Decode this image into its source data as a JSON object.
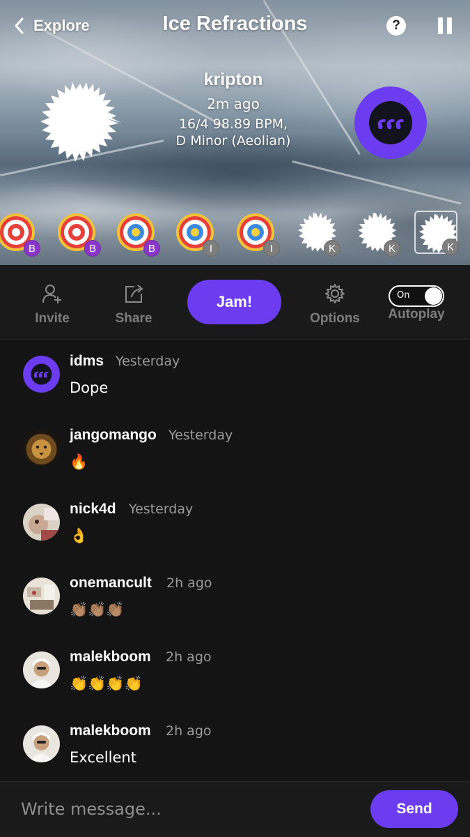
{
  "header": {
    "back_label": "Explore",
    "title": "Ice Refractions",
    "help_label": "?"
  },
  "song": {
    "author": "kripton",
    "time_ago": "2m ago",
    "tempo": "16/4 98.89 BPM,",
    "key": "D Minor (Aeolian)"
  },
  "instruments": [
    {
      "badge": "B",
      "style": "ring-red",
      "selected": false
    },
    {
      "badge": "B",
      "style": "ring-red",
      "selected": false
    },
    {
      "badge": "B",
      "style": "ring-blue",
      "selected": false
    },
    {
      "badge": "I",
      "style": "ring-blue",
      "selected": false
    },
    {
      "badge": "I",
      "style": "ring-blue",
      "selected": false
    },
    {
      "badge": "K",
      "style": "blob-white",
      "selected": false
    },
    {
      "badge": "K",
      "style": "blob-white",
      "selected": false
    },
    {
      "badge": "K",
      "style": "blob-white",
      "selected": true
    }
  ],
  "toolbar": {
    "invite_label": "Invite",
    "share_label": "Share",
    "jam_label": "Jam!",
    "options_label": "Options",
    "autoplay_label": "Autoplay",
    "autoplay_state": "On"
  },
  "messages": [
    {
      "user": "idms",
      "time": "Yesterday",
      "text": "Dope",
      "avatar": "logo"
    },
    {
      "user": "jangomango",
      "time": "Yesterday",
      "text": "🔥",
      "avatar": "lion"
    },
    {
      "user": "nick4d",
      "time": "Yesterday",
      "text": "👌",
      "avatar": "photo-room"
    },
    {
      "user": "onemancult",
      "time": "2h ago",
      "text": "👏🏽👏🏽👏🏽",
      "avatar": "photo-room2"
    },
    {
      "user": "malekboom",
      "time": "2h ago",
      "text": "👏👏👏👏",
      "avatar": "photo-man"
    },
    {
      "user": "malekboom",
      "time": "2h ago",
      "text": "Excellent",
      "avatar": "photo-man"
    }
  ],
  "composer": {
    "placeholder": "Write message...",
    "send_label": "Send"
  },
  "colors": {
    "accent": "#6c3cf0",
    "background": "#141414",
    "toolbar": "#1a1a1a",
    "muted_text": "#9a9a9a"
  }
}
